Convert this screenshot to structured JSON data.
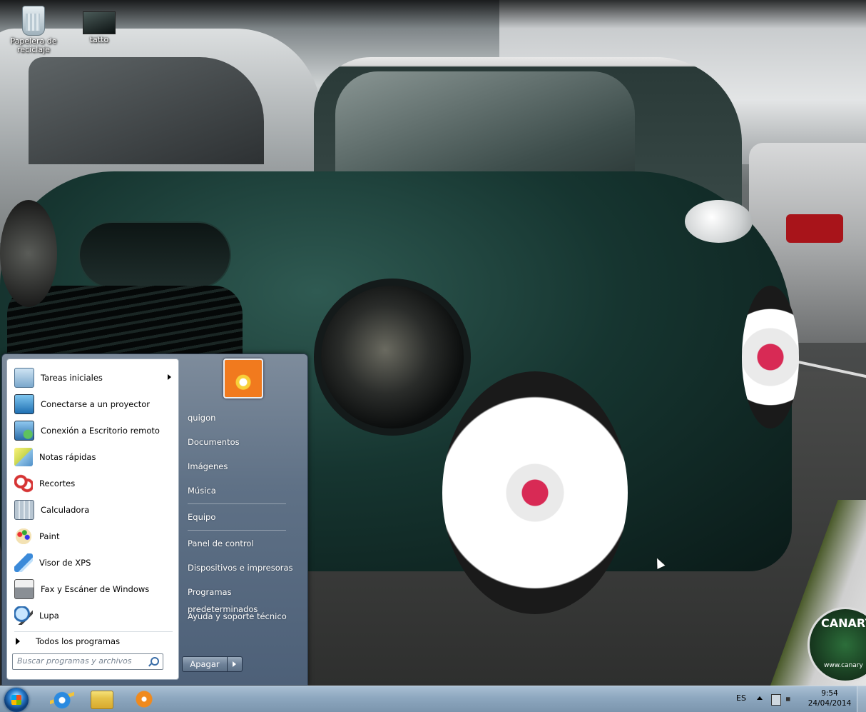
{
  "desktop": {
    "icons": [
      {
        "label": "Papelera de reciclaje",
        "icon": "recycle-bin-icon"
      },
      {
        "label": "tatto",
        "icon": "image-file-icon"
      }
    ],
    "watermark": "CANARY",
    "watermark_url": "www.canary"
  },
  "start_menu": {
    "programs": [
      {
        "label": "Tareas iniciales",
        "icon": "getting-started-icon",
        "has_submenu": true
      },
      {
        "label": "Conectarse a un proyector",
        "icon": "projector-icon"
      },
      {
        "label": "Conexión a Escritorio remoto",
        "icon": "remote-desktop-icon"
      },
      {
        "label": "Notas rápidas",
        "icon": "sticky-notes-icon"
      },
      {
        "label": "Recortes",
        "icon": "snipping-tool-icon"
      },
      {
        "label": "Calculadora",
        "icon": "calculator-icon"
      },
      {
        "label": "Paint",
        "icon": "paint-icon"
      },
      {
        "label": "Visor de XPS",
        "icon": "xps-viewer-icon"
      },
      {
        "label": "Fax y Escáner de Windows",
        "icon": "fax-scanner-icon"
      },
      {
        "label": "Lupa",
        "icon": "magnifier-icon"
      }
    ],
    "all_programs_label": "Todos los programas",
    "search_placeholder": "Buscar programas y archivos",
    "right_items": [
      "quigon",
      "Documentos",
      "Imágenes",
      "Música",
      "Equipo",
      "Panel de control",
      "Dispositivos e impresoras",
      "Programas predeterminados",
      "Ayuda y soporte técnico"
    ],
    "shutdown_label": "Apagar"
  },
  "taskbar": {
    "pinned": [
      "start-orb-icon",
      "internet-explorer-icon",
      "windows-explorer-icon",
      "media-player-icon"
    ],
    "language": "ES",
    "time": "9:54",
    "date": "24/04/2014"
  }
}
